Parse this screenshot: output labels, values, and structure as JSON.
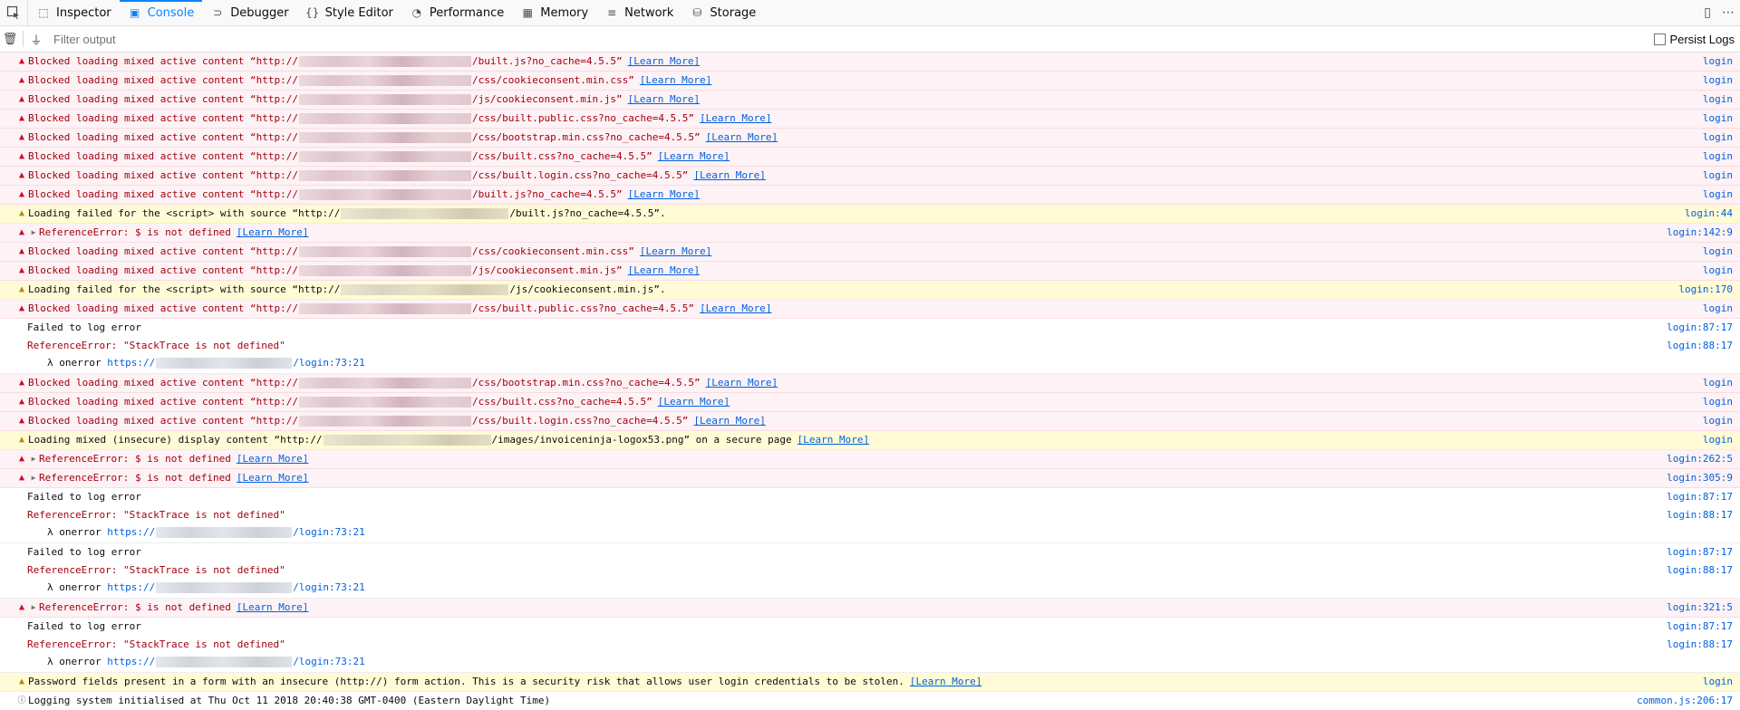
{
  "toolbar": {
    "tabs": [
      {
        "label": "Inspector",
        "icon": "inspector-icon",
        "glyph": "⬚"
      },
      {
        "label": "Console",
        "icon": "console-icon",
        "glyph": "▣"
      },
      {
        "label": "Debugger",
        "icon": "debugger-icon",
        "glyph": "⊃"
      },
      {
        "label": "Style Editor",
        "icon": "style-editor-icon",
        "glyph": "{}"
      },
      {
        "label": "Performance",
        "icon": "performance-icon",
        "glyph": "◔"
      },
      {
        "label": "Memory",
        "icon": "memory-icon",
        "glyph": "▦"
      },
      {
        "label": "Network",
        "icon": "network-icon",
        "glyph": "≡"
      },
      {
        "label": "Storage",
        "icon": "storage-icon",
        "glyph": "⛁"
      }
    ],
    "active_tab": "Console"
  },
  "filterbar": {
    "placeholder": "Filter output",
    "persist_label": "Persist Logs"
  },
  "learn_more": "[Learn More]",
  "messages": [
    {
      "kind": "error",
      "prefix": "Blocked loading mixed active content “http://",
      "redacted": true,
      "suffix": "/built.js?no_cache=4.5.5”",
      "learn": true,
      "location": "login"
    },
    {
      "kind": "error",
      "prefix": "Blocked loading mixed active content “http://",
      "redacted": true,
      "suffix": "/css/cookieconsent.min.css”",
      "learn": true,
      "location": "login"
    },
    {
      "kind": "error",
      "prefix": "Blocked loading mixed active content “http://",
      "redacted": true,
      "suffix": "/js/cookieconsent.min.js”",
      "learn": true,
      "location": "login"
    },
    {
      "kind": "error",
      "prefix": "Blocked loading mixed active content “http://",
      "redacted": true,
      "suffix": "/css/built.public.css?no_cache=4.5.5”",
      "learn": true,
      "location": "login"
    },
    {
      "kind": "error",
      "prefix": "Blocked loading mixed active content “http://",
      "redacted": true,
      "suffix": "/css/bootstrap.min.css?no_cache=4.5.5”",
      "learn": true,
      "location": "login"
    },
    {
      "kind": "error",
      "prefix": "Blocked loading mixed active content “http://",
      "redacted": true,
      "suffix": "/css/built.css?no_cache=4.5.5”",
      "learn": true,
      "location": "login"
    },
    {
      "kind": "error",
      "prefix": "Blocked loading mixed active content “http://",
      "redacted": true,
      "suffix": "/css/built.login.css?no_cache=4.5.5”",
      "learn": true,
      "location": "login"
    },
    {
      "kind": "error",
      "prefix": "Blocked loading mixed active content “http://",
      "redacted": true,
      "suffix": "/built.js?no_cache=4.5.5”",
      "learn": true,
      "location": "login"
    },
    {
      "kind": "warn",
      "prefix": "Loading failed for the <script> with source “http://",
      "redacted": true,
      "suffix": "/built.js?no_cache=4.5.5”.",
      "learn": false,
      "location": "login:44"
    },
    {
      "kind": "error",
      "expandable": true,
      "prefix": "ReferenceError: $ is not defined",
      "redacted": false,
      "suffix": "",
      "learn": true,
      "location": "login:142:9"
    },
    {
      "kind": "error",
      "prefix": "Blocked loading mixed active content “http://",
      "redacted": true,
      "suffix": "/css/cookieconsent.min.css”",
      "learn": true,
      "location": "login"
    },
    {
      "kind": "error",
      "prefix": "Blocked loading mixed active content “http://",
      "redacted": true,
      "suffix": "/js/cookieconsent.min.js”",
      "learn": true,
      "location": "login"
    },
    {
      "kind": "warn",
      "prefix": "Loading failed for the <script> with source “http://",
      "redacted": true,
      "suffix": "/js/cookieconsent.min.js”.",
      "learn": false,
      "location": "login:170"
    },
    {
      "kind": "error",
      "prefix": "Blocked loading mixed active content “http://",
      "redacted": true,
      "suffix": "/css/built.public.css?no_cache=4.5.5”",
      "learn": true,
      "location": "login"
    },
    {
      "kind": "logblock",
      "text": "Failed to log error",
      "location": "login:87:17",
      "error": "ReferenceError: \"StackTrace is not defined\"",
      "error_location": "login:88:17",
      "trace_prefix": "λ onerror ",
      "trace_scheme": "https://",
      "trace_suffix": "/login:73:21"
    },
    {
      "kind": "error",
      "prefix": "Blocked loading mixed active content “http://",
      "redacted": true,
      "suffix": "/css/bootstrap.min.css?no_cache=4.5.5”",
      "learn": true,
      "location": "login"
    },
    {
      "kind": "error",
      "prefix": "Blocked loading mixed active content “http://",
      "redacted": true,
      "suffix": "/css/built.css?no_cache=4.5.5”",
      "learn": true,
      "location": "login"
    },
    {
      "kind": "error",
      "prefix": "Blocked loading mixed active content “http://",
      "redacted": true,
      "suffix": "/css/built.login.css?no_cache=4.5.5”",
      "learn": true,
      "location": "login"
    },
    {
      "kind": "warn",
      "prefix": "Loading mixed (insecure) display content “http://",
      "redacted": true,
      "suffix": "/images/invoiceninja-logox53.png” on a secure page",
      "learn": true,
      "location": "login"
    },
    {
      "kind": "error",
      "expandable": true,
      "prefix": "ReferenceError: $ is not defined",
      "redacted": false,
      "suffix": "",
      "learn": true,
      "location": "login:262:5"
    },
    {
      "kind": "error",
      "expandable": true,
      "prefix": "ReferenceError: $ is not defined",
      "redacted": false,
      "suffix": "",
      "learn": true,
      "location": "login:305:9"
    },
    {
      "kind": "logblock",
      "text": "Failed to log error",
      "location": "login:87:17",
      "error": "ReferenceError: \"StackTrace is not defined\"",
      "error_location": "login:88:17",
      "trace_prefix": "λ onerror ",
      "trace_scheme": "https://",
      "trace_suffix": "/login:73:21"
    },
    {
      "kind": "logblock",
      "text": "Failed to log error",
      "location": "login:87:17",
      "error": "ReferenceError: \"StackTrace is not defined\"",
      "error_location": "login:88:17",
      "trace_prefix": "λ onerror ",
      "trace_scheme": "https://",
      "trace_suffix": "/login:73:21"
    },
    {
      "kind": "error",
      "expandable": true,
      "prefix": "ReferenceError: $ is not defined",
      "redacted": false,
      "suffix": "",
      "learn": true,
      "location": "login:321:5"
    },
    {
      "kind": "logblock",
      "text": "Failed to log error",
      "location": "login:87:17",
      "error": "ReferenceError: \"StackTrace is not defined\"",
      "error_location": "login:88:17",
      "trace_prefix": "λ onerror ",
      "trace_scheme": "https://",
      "trace_suffix": "/login:73:21"
    },
    {
      "kind": "warn",
      "prefix": "Password fields present in a form with an insecure (http://) form action. This is a security risk that allows user login credentials to be stolen.",
      "redacted": false,
      "suffix": "",
      "learn": true,
      "location": "login"
    },
    {
      "kind": "info",
      "prefix": "Logging system initialised at Thu Oct 11 2018 20:40:38 GMT-0400 (Eastern Daylight Time)",
      "redacted": false,
      "suffix": "",
      "learn": false,
      "location": "common.js:206:17"
    }
  ]
}
